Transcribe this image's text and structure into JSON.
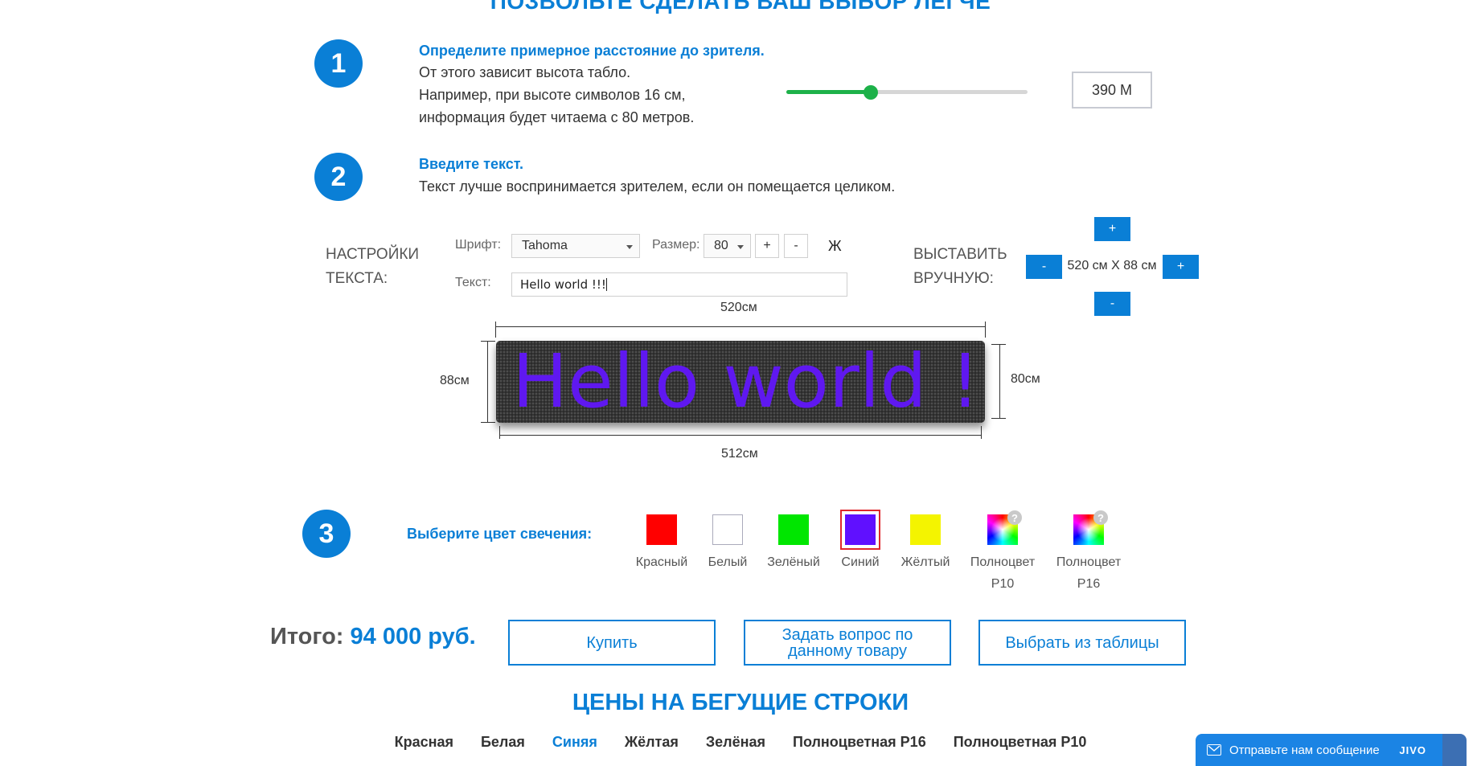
{
  "top_heading": "ПОЗВОЛЬТЕ СДЕЛАТЬ ВАШ ВЫБОР ЛЕГЧЕ",
  "step1": {
    "number": "1",
    "title": "Определите примерное расстояние до зрителя.",
    "lines": [
      "От этого зависит высота табло.",
      "Например, при высоте символов 16 см,",
      "информация будет читаема с 80 метров."
    ],
    "slider_fraction": 0.35,
    "distance_value": "390 М"
  },
  "step2": {
    "number": "2",
    "title": "Введите текст.",
    "text": "Текст лучше воспринимается зрителем, если он помещается целиком."
  },
  "text_settings": {
    "label_line1": "НАСТРОЙКИ",
    "label_line2": "ТЕКСТА:",
    "font_label": "Шрифт:",
    "font_value": "Tahoma",
    "size_label": "Размер:",
    "size_value": "80",
    "plus": "+",
    "minus": "-",
    "bold": "Ж",
    "text_label": "Текст:",
    "text_value": "Hello world !!!"
  },
  "manual": {
    "label_line1": "ВЫСТАВИТЬ",
    "label_line2": "ВРУЧНУЮ:",
    "size_readout": "520 см Х 88 см",
    "plus": "+",
    "minus": "-"
  },
  "preview": {
    "width_top": "520см",
    "width_bottom": "512см",
    "height_left": "88см",
    "height_right": "80см",
    "display_text": "Hello world !!!",
    "led_color": "#5f18f0"
  },
  "step3": {
    "number": "3",
    "title": "Выберите цвет свечения:",
    "selected": "Синий",
    "colors": [
      {
        "name": "Красный",
        "hex": "#ff0000"
      },
      {
        "name": "Белый",
        "hex": "#ffffff"
      },
      {
        "name": "Зелёный",
        "hex": "#00e600"
      },
      {
        "name": "Синий",
        "hex": "#6010ff"
      },
      {
        "name": "Жёлтый",
        "hex": "#f4f400"
      },
      {
        "name": "Полноцвет",
        "sub": "P10",
        "hex": "rainbow"
      },
      {
        "name": "Полноцвет",
        "sub": "P16",
        "hex": "rainbow"
      }
    ],
    "help": "?"
  },
  "total": {
    "label": "Итого:",
    "value": "94 000 руб."
  },
  "actions": {
    "buy": "Купить",
    "ask_line1": "Задать вопрос по",
    "ask_line2": "данному товару",
    "table": "Выбрать из таблицы"
  },
  "prices_heading": "ЦЕНЫ НА БЕГУЩИЕ СТРОКИ",
  "price_tabs": [
    "Красная",
    "Белая",
    "Синяя",
    "Жёлтая",
    "Зелёная",
    "Полноцветная P16",
    "Полноцветная P10"
  ],
  "active_price_tab": "Синяя",
  "chat": {
    "text": "Отправьте нам сообщение",
    "brand": "JIVO"
  },
  "accent_color": "#0a7fd6"
}
